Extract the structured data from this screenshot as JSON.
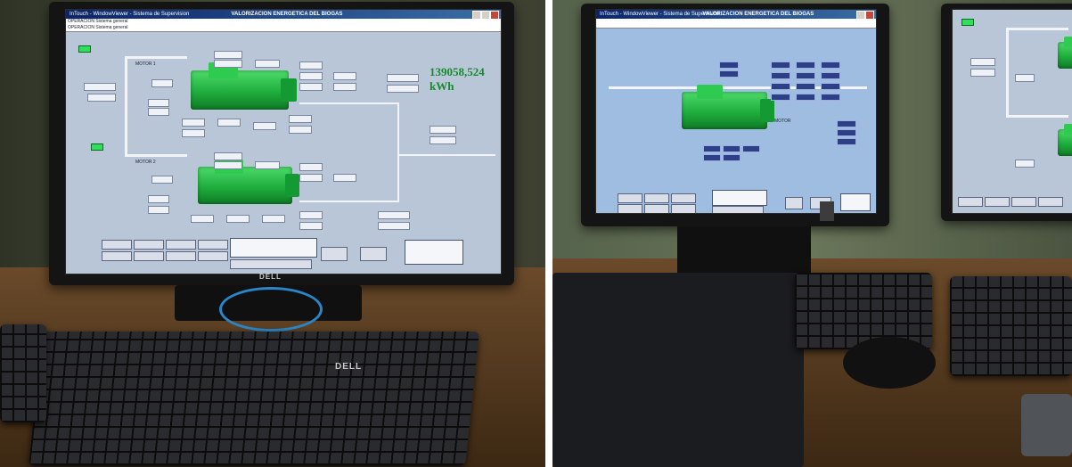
{
  "left_monitor": {
    "title": "InTouch - WindowViewer - Sistema de Supervision",
    "screen_heading": "VALORIZACION ENERGETICA DEL BIOGAS",
    "alarm_rows": [
      "OPERACION  Sistema general",
      "OPERACION  Sistema general"
    ],
    "counter": "139058,524 kWh",
    "generator_1_label": "MOTOR 1",
    "generator_2_label": "MOTOR 2",
    "monitor_brand": "DELL",
    "keyboard_brand": "DELL"
  },
  "right_monitor": {
    "title": "InTouch - WindowViewer - Sistema de Supervision",
    "screen_heading": "VALORIZACION ENERGETICA DEL BIOGAS",
    "motor_label": "MOTOR"
  },
  "colors": {
    "screen_bg": "#b9c6d8",
    "generator_green": "#1fae3d",
    "counter_green": "#138c2a",
    "titlebar_blue": "#0a246a",
    "cable_blue": "#2a86c8"
  }
}
